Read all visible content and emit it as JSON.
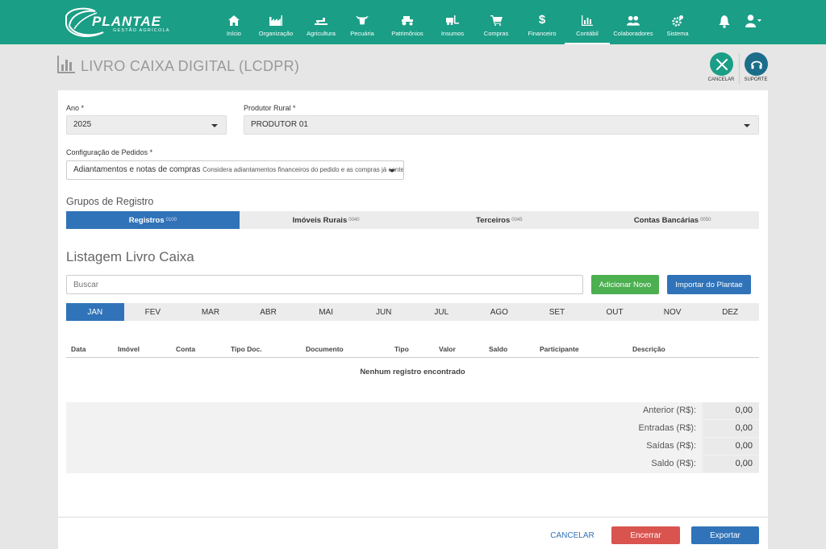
{
  "header": {
    "logo_text": "PLANTAE",
    "logo_sub": "GESTÃO AGRÍCOLA",
    "nav": [
      {
        "label": "Início",
        "icon": "home-icon"
      },
      {
        "label": "Organização",
        "icon": "factory-icon"
      },
      {
        "label": "Agricultura",
        "icon": "tractor-field-icon"
      },
      {
        "label": "Pecuária",
        "icon": "cow-icon"
      },
      {
        "label": "Patrimônios",
        "icon": "tractor-icon"
      },
      {
        "label": "Insumos",
        "icon": "forklift-icon"
      },
      {
        "label": "Compras",
        "icon": "cart-icon"
      },
      {
        "label": "Financeiro",
        "icon": "dollar-icon"
      },
      {
        "label": "Contábil",
        "icon": "chart-icon"
      },
      {
        "label": "Colaboradores",
        "icon": "users-icon"
      },
      {
        "label": "Sistema",
        "icon": "gears-icon"
      }
    ],
    "active_nav": "Contábil",
    "accent_color": "#1a9e86"
  },
  "page": {
    "title": "LIVRO CAIXA DIGITAL (LCDPR)",
    "cancel_label": "CANCELAR",
    "support_label": "SUPORTE"
  },
  "form": {
    "ano_label": "Ano *",
    "ano_value": "2025",
    "produtor_label": "Produtor Rural *",
    "produtor_value": "PRODUTOR 01",
    "config_label": "Configuração de Pedidos *",
    "config_value": "Adiantamentos e notas de compras",
    "config_hint": "Considera adiantamentos financeiros do pedido e as compras já contemp"
  },
  "groups": {
    "title": "Grupos de Registro",
    "tabs": [
      {
        "label": "Registros",
        "code": "0100"
      },
      {
        "label": "Imóveis Rurais",
        "code": "0040"
      },
      {
        "label": "Terceiros",
        "code": "0045"
      },
      {
        "label": "Contas Bancárias",
        "code": "0050"
      }
    ]
  },
  "listing": {
    "title": "Listagem Livro Caixa",
    "search_placeholder": "Buscar",
    "add_label": "Adicionar Novo",
    "import_label": "Importar do Plantae",
    "months": [
      "JAN",
      "FEV",
      "MAR",
      "ABR",
      "MAI",
      "JUN",
      "JUL",
      "AGO",
      "SET",
      "OUT",
      "NOV",
      "DEZ"
    ],
    "active_month": "JAN",
    "columns": [
      "Data",
      "Imóvel",
      "Conta",
      "Tipo Doc.",
      "Documento",
      "Tipo",
      "Valor",
      "Saldo",
      "Participante",
      "Descrição"
    ],
    "empty_message": "Nenhum registro encontrado"
  },
  "totals": [
    {
      "label": "Anterior (R$):",
      "value": "0,00"
    },
    {
      "label": "Entradas (R$):",
      "value": "0,00"
    },
    {
      "label": "Saídas (R$):",
      "value": "0,00"
    },
    {
      "label": "Saldo (R$):",
      "value": "0,00"
    }
  ],
  "footer": {
    "cancel_label": "CANCELAR",
    "close_label": "Encerrar",
    "export_label": "Exportar"
  }
}
